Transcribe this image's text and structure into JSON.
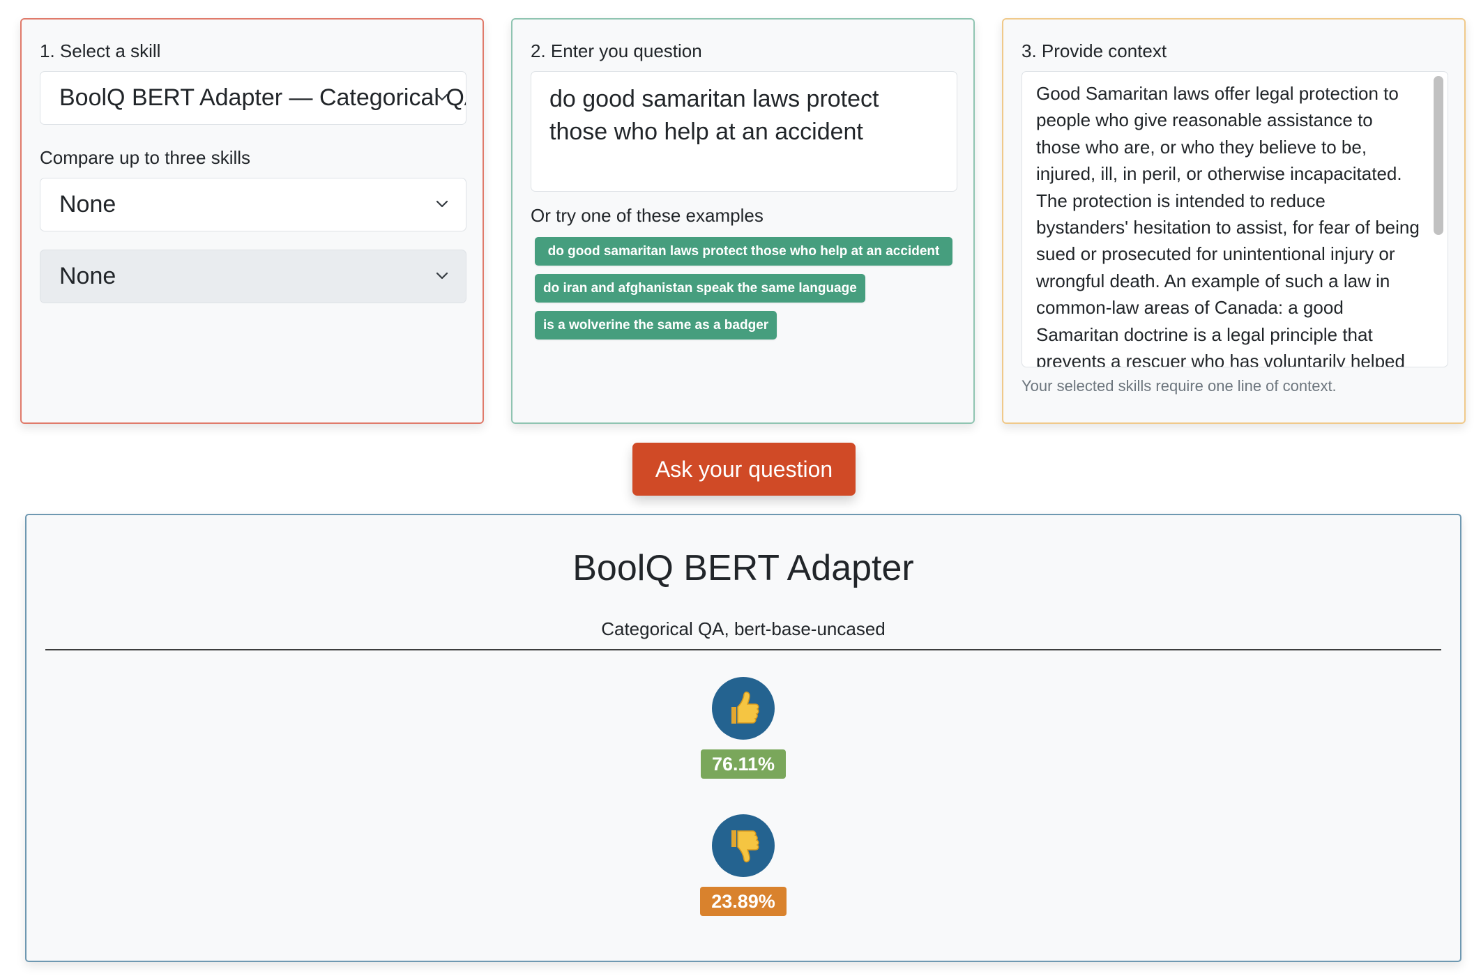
{
  "skill_panel": {
    "label": "1. Select a skill",
    "selected_skill": "BoolQ BERT Adapter — Categorical QA, bert-base-uncased",
    "compare_label": "Compare up to three skills",
    "compare_1": "None",
    "compare_2": "None"
  },
  "question_panel": {
    "label": "2. Enter you question",
    "question": "do good samaritan laws protect those who help at an accident",
    "examples_label": "Or try one of these examples",
    "examples": [
      "do good samaritan laws protect those who help at an accident",
      "do iran and afghanistan speak the same language",
      "is a wolverine the same as a badger"
    ]
  },
  "context_panel": {
    "label": "3. Provide context",
    "context": "Good Samaritan laws offer legal protection to people who give reasonable assistance to those who are, or who they believe to be, injured, ill, in peril, or otherwise incapacitated. The protection is intended to reduce bystanders' hesitation to assist, for fear of being sued or prosecuted for unintentional injury or wrongful death. An example of such a law in common-law areas of Canada: a good Samaritan doctrine is a legal principle that prevents a rescuer who has voluntarily helped",
    "help_text": "Your selected skills require one line of context."
  },
  "ask_button": "Ask your question",
  "result": {
    "title": "BoolQ BERT Adapter",
    "subtitle": "Categorical QA, bert-base-uncased",
    "yes_icon": "thumbs-up-icon",
    "no_icon": "thumbs-down-icon",
    "yes_score": "76.11%",
    "no_score": "23.89%"
  },
  "colors": {
    "skill_border": "#e07a6a",
    "question_border": "#8fc4b1",
    "context_border": "#f0c98a",
    "example_button": "#469e7e",
    "ask_button": "#d04a26",
    "result_border": "#6e98b1",
    "icon_circle": "#246390",
    "yes_badge": "#7aa75b",
    "no_badge": "#d9822d"
  }
}
